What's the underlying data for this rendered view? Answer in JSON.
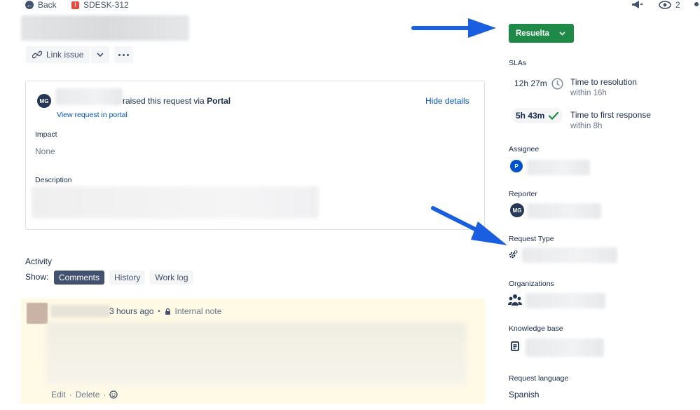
{
  "topbar": {
    "back_label": "Back",
    "issue_key": "SDESK-312",
    "watchers_count": "2"
  },
  "toolbar": {
    "link_issue_label": "Link issue"
  },
  "request_card": {
    "raised_text": "raised this request via",
    "channel": "Portal",
    "reporter_initials": "MG",
    "hide_details_label": "Hide details",
    "view_request_label": "View request in portal",
    "impact_label": "Impact",
    "impact_value": "None",
    "description_label": "Description"
  },
  "activity": {
    "title": "Activity",
    "show_label": "Show:",
    "tabs": [
      {
        "label": "Comments",
        "active": true
      },
      {
        "label": "History",
        "active": false
      },
      {
        "label": "Work log",
        "active": false
      }
    ],
    "comment": {
      "time": "3 hours ago",
      "separator": "•",
      "note_label": "Internal note",
      "edit_label": "Edit",
      "delete_label": "Delete",
      "dot": "·"
    }
  },
  "sidebar": {
    "status_label": "Resuelta",
    "slas_label": "SLAs",
    "slas": [
      {
        "time": "12h 27m",
        "name": "Time to resolution",
        "target": "within 16h",
        "state": "running"
      },
      {
        "time": "5h 43m",
        "name": "Time to first response",
        "target": "within 8h",
        "state": "met"
      }
    ],
    "assignee_label": "Assignee",
    "assignee_initial": "P",
    "reporter_label": "Reporter",
    "reporter_initials": "MG",
    "request_type_label": "Request Type",
    "organizations_label": "Organizations",
    "knowledge_base_label": "Knowledge base",
    "request_language_label": "Request language",
    "request_language_value": "Spanish"
  },
  "colors": {
    "status_green": "#1f8a47",
    "annotation_arrow": "#1a5fe0",
    "comment_bg": "#fffae6",
    "link_blue": "#0052cc"
  }
}
